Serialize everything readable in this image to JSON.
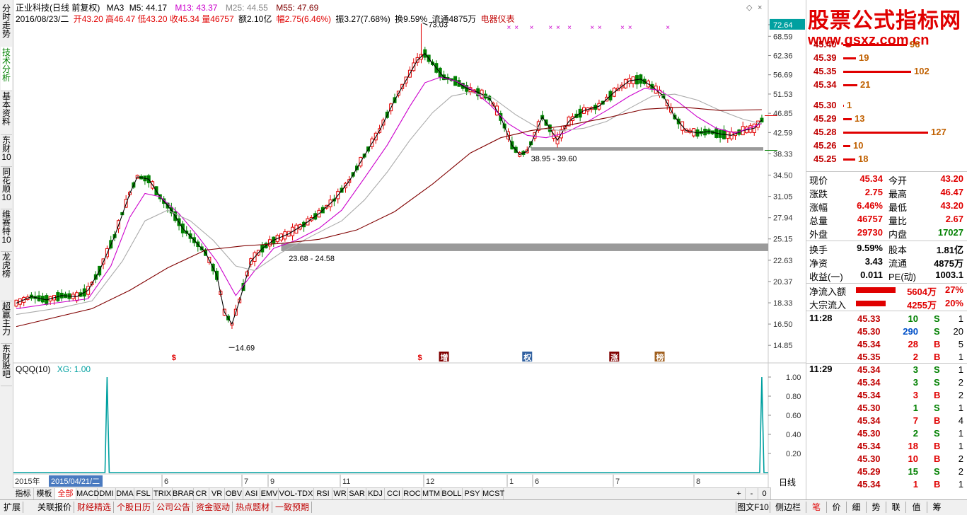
{
  "left_tabs": [
    {
      "label": "分时走势"
    },
    {
      "label": "技术分析"
    },
    {
      "label": "基本资料"
    },
    {
      "label": "东财10"
    },
    {
      "label": "同花顺10"
    },
    {
      "label": "维赛特10"
    },
    {
      "label": "龙虎榜"
    },
    {
      "label": "超赢主力"
    },
    {
      "label": "东财股吧"
    }
  ],
  "header": {
    "title": "正业科技(日线 前复权)",
    "ma_name": "MA3",
    "ma5": "M5: 44.17",
    "ma13": "M13: 43.37",
    "ma25": "M25: 44.55",
    "ma55": "M55: 47.69",
    "date": "2016/08/23/二",
    "open": "开43.20",
    "high": "高46.47",
    "low": "低43.20",
    "close": "收45.34",
    "volume": "量46757",
    "amount": "额2.10亿",
    "change": "幅2.75(6.46%)",
    "amplitude": "振3.27(7.68%)",
    "turnover": "换9.59%",
    "float": "流通4875万",
    "industry": "电器仪表"
  },
  "colors": {
    "up": "#e00000",
    "down": "#008000",
    "ma3": "#000000",
    "ma13": "#cc00cc",
    "ma25": "#999999",
    "ma55": "#800000",
    "accent": "#00a0a0"
  },
  "price_axis": [
    "72.64",
    "68.59",
    "62.36",
    "56.69",
    "51.53",
    "46.85",
    "42.59",
    "38.33",
    "34.50",
    "31.05",
    "27.94",
    "25.15",
    "22.63",
    "20.37",
    "18.33",
    "16.50",
    "14.85"
  ],
  "annotations": {
    "peak": "73.03",
    "low": "14.69",
    "support1": "23.68 - 24.58",
    "support2": "38.95 - 39.60"
  },
  "event_labels": [
    "$",
    "$",
    "增",
    "权",
    "涨",
    "榜"
  ],
  "indicator": {
    "title": "QQQ(10)",
    "xg": "XG: 1.00",
    "axis": [
      "1.00",
      "0.80",
      "0.60",
      "0.40",
      "0.20"
    ]
  },
  "time_axis": {
    "year": "2015年",
    "date_box": "2015/04/21/二",
    "months": [
      "6",
      "7",
      "9",
      "11",
      "12",
      "1",
      "6",
      "7",
      "8"
    ],
    "period": "日线"
  },
  "bottom_tabs": [
    "指标",
    "模板",
    "全部",
    "MACD",
    "DMI",
    "DMA",
    "FSL",
    "TRIX",
    "BRAR",
    "CR",
    "VR",
    "OBV",
    "ASI",
    "EMV",
    "VOL-TDX",
    "RSI",
    "WR",
    "SAR",
    "KDJ",
    "CCI",
    "ROC",
    "MTM",
    "BOLL",
    "PSY",
    "MCST"
  ],
  "zoom": [
    "+",
    "-",
    "0"
  ],
  "watermark": {
    "line1": "股票公式指标网",
    "line2": "www.gsxz.com.cn"
  },
  "order_book": [
    {
      "price": "45.40",
      "vol": "96",
      "bar": 0.75
    },
    {
      "price": "45.39",
      "vol": "19",
      "bar": 0.15
    },
    {
      "price": "45.35",
      "vol": "102",
      "bar": 0.8
    },
    {
      "price": "45.34",
      "vol": "21",
      "bar": 0.17
    },
    {
      "price": "45.30",
      "vol": "1",
      "bar": 0.01
    },
    {
      "price": "45.29",
      "vol": "13",
      "bar": 0.1
    },
    {
      "price": "45.28",
      "vol": "127",
      "bar": 1.0
    },
    {
      "price": "45.26",
      "vol": "10",
      "bar": 0.08
    },
    {
      "price": "45.25",
      "vol": "18",
      "bar": 0.14
    }
  ],
  "quote": [
    {
      "l1": "现价",
      "v1": "45.34",
      "l2": "今开",
      "v2": "43.20"
    },
    {
      "l1": "涨跌",
      "v1": "2.75",
      "l2": "最高",
      "v2": "46.47"
    },
    {
      "l1": "涨幅",
      "v1": "6.46%",
      "l2": "最低",
      "v2": "43.20"
    },
    {
      "l1": "总量",
      "v1": "46757",
      "l2": "量比",
      "v2": "2.67"
    },
    {
      "l1": "外盘",
      "v1": "29730",
      "l2": "内盘",
      "v2": "17027"
    }
  ],
  "fund": [
    {
      "l1": "换手",
      "v1": "9.59%",
      "l2": "股本",
      "v2": "1.81亿"
    },
    {
      "l1": "净资",
      "v1": "3.43",
      "l2": "流通",
      "v2": "4875万"
    },
    {
      "l1": "收益(一)",
      "v1": "0.011",
      "l2": "PE(动)",
      "v2": "1003.1"
    }
  ],
  "flow": [
    {
      "label": "净流入额",
      "value": "5604万",
      "pct": "27%",
      "bar": 0.9
    },
    {
      "label": "大宗流入",
      "value": "4255万",
      "pct": "20%",
      "bar": 0.68
    }
  ],
  "ticks_1128": {
    "time": "11:28",
    "rows": [
      {
        "price": "45.33",
        "vol": "10",
        "side": "S",
        "n": "1"
      },
      {
        "price": "45.30",
        "vol": "290",
        "side": "S",
        "n": "20"
      },
      {
        "price": "45.34",
        "vol": "28",
        "side": "B",
        "n": "5"
      },
      {
        "price": "45.35",
        "vol": "2",
        "side": "B",
        "n": "1"
      }
    ]
  },
  "ticks_1129": {
    "time": "11:29",
    "rows": [
      {
        "price": "45.34",
        "vol": "3",
        "side": "S",
        "n": "1"
      },
      {
        "price": "45.34",
        "vol": "3",
        "side": "S",
        "n": "2"
      },
      {
        "price": "45.34",
        "vol": "3",
        "side": "B",
        "n": "2"
      },
      {
        "price": "45.30",
        "vol": "1",
        "side": "S",
        "n": "1"
      },
      {
        "price": "45.34",
        "vol": "7",
        "side": "B",
        "n": "4"
      },
      {
        "price": "45.30",
        "vol": "2",
        "side": "S",
        "n": "1"
      },
      {
        "price": "45.34",
        "vol": "18",
        "side": "B",
        "n": "1"
      },
      {
        "price": "45.30",
        "vol": "10",
        "side": "B",
        "n": "2"
      },
      {
        "price": "45.29",
        "vol": "15",
        "side": "S",
        "n": "2"
      },
      {
        "price": "45.34",
        "vol": "1",
        "side": "B",
        "n": "1"
      }
    ]
  },
  "status_left": [
    "扩展",
    "关联报价",
    "财经精选",
    "个股日历",
    "公司公告",
    "资金驱动",
    "热点题材",
    "一致预期"
  ],
  "status_right": [
    "图文F10",
    "侧边栏",
    "笔",
    "价",
    "细",
    "势",
    "联",
    "值",
    "筹"
  ],
  "chart_data": {
    "type": "candlestick",
    "title": "正业科技(日线 前复权)",
    "series": [
      {
        "name": "MA3",
        "points": [
          [
            0,
            18.3
          ],
          [
            4,
            18.9
          ],
          [
            8,
            18.6
          ],
          [
            12,
            19.0
          ],
          [
            16,
            18.9
          ],
          [
            19,
            19.5
          ],
          [
            22,
            21.5
          ],
          [
            26,
            25.5
          ],
          [
            30,
            31.5
          ],
          [
            32,
            34.2
          ],
          [
            35,
            33.8
          ],
          [
            38,
            31.0
          ],
          [
            41,
            29.0
          ],
          [
            44,
            26.5
          ],
          [
            47,
            25.0
          ],
          [
            50,
            23.5
          ],
          [
            53,
            21.0
          ],
          [
            55,
            17.5
          ],
          [
            57,
            16.5
          ],
          [
            59,
            18.5
          ],
          [
            62,
            22.5
          ],
          [
            65,
            24.0
          ],
          [
            68,
            25.0
          ],
          [
            72,
            25.8
          ],
          [
            76,
            27.0
          ],
          [
            80,
            28.5
          ],
          [
            84,
            30.5
          ],
          [
            88,
            33.5
          ],
          [
            92,
            38.0
          ],
          [
            96,
            43.0
          ],
          [
            100,
            50.0
          ],
          [
            104,
            57.0
          ],
          [
            106,
            61.0
          ],
          [
            108,
            63.0
          ],
          [
            110,
            60.0
          ],
          [
            113,
            56.0
          ],
          [
            116,
            55.0
          ],
          [
            119,
            53.0
          ],
          [
            122,
            52.0
          ],
          [
            125,
            50.5
          ],
          [
            128,
            46.0
          ],
          [
            131,
            40.0
          ],
          [
            133,
            38.2
          ],
          [
            135,
            38.8
          ],
          [
            137,
            42.0
          ],
          [
            139,
            46.0
          ],
          [
            141,
            43.5
          ],
          [
            143,
            41.0
          ],
          [
            146,
            45.0
          ],
          [
            150,
            47.5
          ],
          [
            154,
            48.5
          ],
          [
            158,
            52.0
          ],
          [
            162,
            55.0
          ],
          [
            165,
            55.5
          ],
          [
            168,
            53.5
          ],
          [
            171,
            51.0
          ],
          [
            174,
            46.0
          ],
          [
            177,
            43.0
          ],
          [
            180,
            42.5
          ],
          [
            183,
            42.8
          ],
          [
            186,
            42.3
          ],
          [
            189,
            42.0
          ],
          [
            192,
            43.0
          ],
          [
            195,
            43.5
          ],
          [
            197,
            45.3
          ]
        ]
      },
      {
        "name": "MA13",
        "points": [
          [
            0,
            17.8
          ],
          [
            10,
            18.3
          ],
          [
            19,
            18.7
          ],
          [
            25,
            22.0
          ],
          [
            30,
            28.0
          ],
          [
            34,
            31.5
          ],
          [
            38,
            31.0
          ],
          [
            43,
            28.5
          ],
          [
            48,
            25.5
          ],
          [
            53,
            22.5
          ],
          [
            58,
            19.0
          ],
          [
            63,
            21.5
          ],
          [
            68,
            24.0
          ],
          [
            74,
            25.0
          ],
          [
            80,
            26.5
          ],
          [
            86,
            29.0
          ],
          [
            92,
            34.0
          ],
          [
            98,
            40.0
          ],
          [
            104,
            48.5
          ],
          [
            108,
            54.5
          ],
          [
            112,
            56.0
          ],
          [
            116,
            55.0
          ],
          [
            120,
            53.0
          ],
          [
            125,
            49.0
          ],
          [
            130,
            44.5
          ],
          [
            135,
            42.0
          ],
          [
            140,
            41.5
          ],
          [
            145,
            42.5
          ],
          [
            150,
            44.5
          ],
          [
            156,
            47.5
          ],
          [
            162,
            51.0
          ],
          [
            166,
            53.0
          ],
          [
            170,
            52.5
          ],
          [
            175,
            49.5
          ],
          [
            180,
            46.0
          ],
          [
            185,
            43.5
          ],
          [
            190,
            42.5
          ],
          [
            197,
            44.5
          ]
        ]
      },
      {
        "name": "MA25",
        "points": [
          [
            0,
            17.3
          ],
          [
            12,
            17.9
          ],
          [
            20,
            18.5
          ],
          [
            28,
            22.5
          ],
          [
            34,
            27.5
          ],
          [
            40,
            29.0
          ],
          [
            46,
            27.5
          ],
          [
            52,
            25.0
          ],
          [
            58,
            22.0
          ],
          [
            63,
            21.5
          ],
          [
            70,
            23.5
          ],
          [
            78,
            25.5
          ],
          [
            86,
            27.5
          ],
          [
            92,
            30.5
          ],
          [
            98,
            35.0
          ],
          [
            104,
            41.0
          ],
          [
            110,
            47.0
          ],
          [
            115,
            51.0
          ],
          [
            120,
            52.0
          ],
          [
            126,
            50.5
          ],
          [
            132,
            46.5
          ],
          [
            138,
            43.5
          ],
          [
            144,
            43.0
          ],
          [
            150,
            43.5
          ],
          [
            156,
            45.0
          ],
          [
            162,
            48.0
          ],
          [
            168,
            51.0
          ],
          [
            174,
            51.5
          ],
          [
            180,
            50.0
          ],
          [
            186,
            47.5
          ],
          [
            192,
            45.5
          ],
          [
            197,
            44.5
          ]
        ]
      },
      {
        "name": "MA55",
        "points": [
          [
            0,
            16.3
          ],
          [
            20,
            17.8
          ],
          [
            30,
            19.5
          ],
          [
            40,
            21.8
          ],
          [
            50,
            23.8
          ],
          [
            60,
            24.3
          ],
          [
            70,
            24.6
          ],
          [
            80,
            25.1
          ],
          [
            90,
            26.3
          ],
          [
            100,
            28.8
          ],
          [
            110,
            33.0
          ],
          [
            120,
            38.5
          ],
          [
            128,
            41.5
          ],
          [
            136,
            43.0
          ],
          [
            146,
            44.2
          ],
          [
            156,
            45.8
          ],
          [
            166,
            47.8
          ],
          [
            176,
            48.3
          ],
          [
            186,
            47.5
          ],
          [
            197,
            47.7
          ]
        ]
      }
    ],
    "annotations": {
      "high": 73.03,
      "low": 14.69,
      "support_band_1": [
        23.68,
        24.58
      ],
      "support_band_2": [
        38.95,
        39.6
      ]
    },
    "indicator": {
      "name": "QQQ(10)",
      "signals_at": [
        24,
        197
      ],
      "value": 1.0
    }
  }
}
